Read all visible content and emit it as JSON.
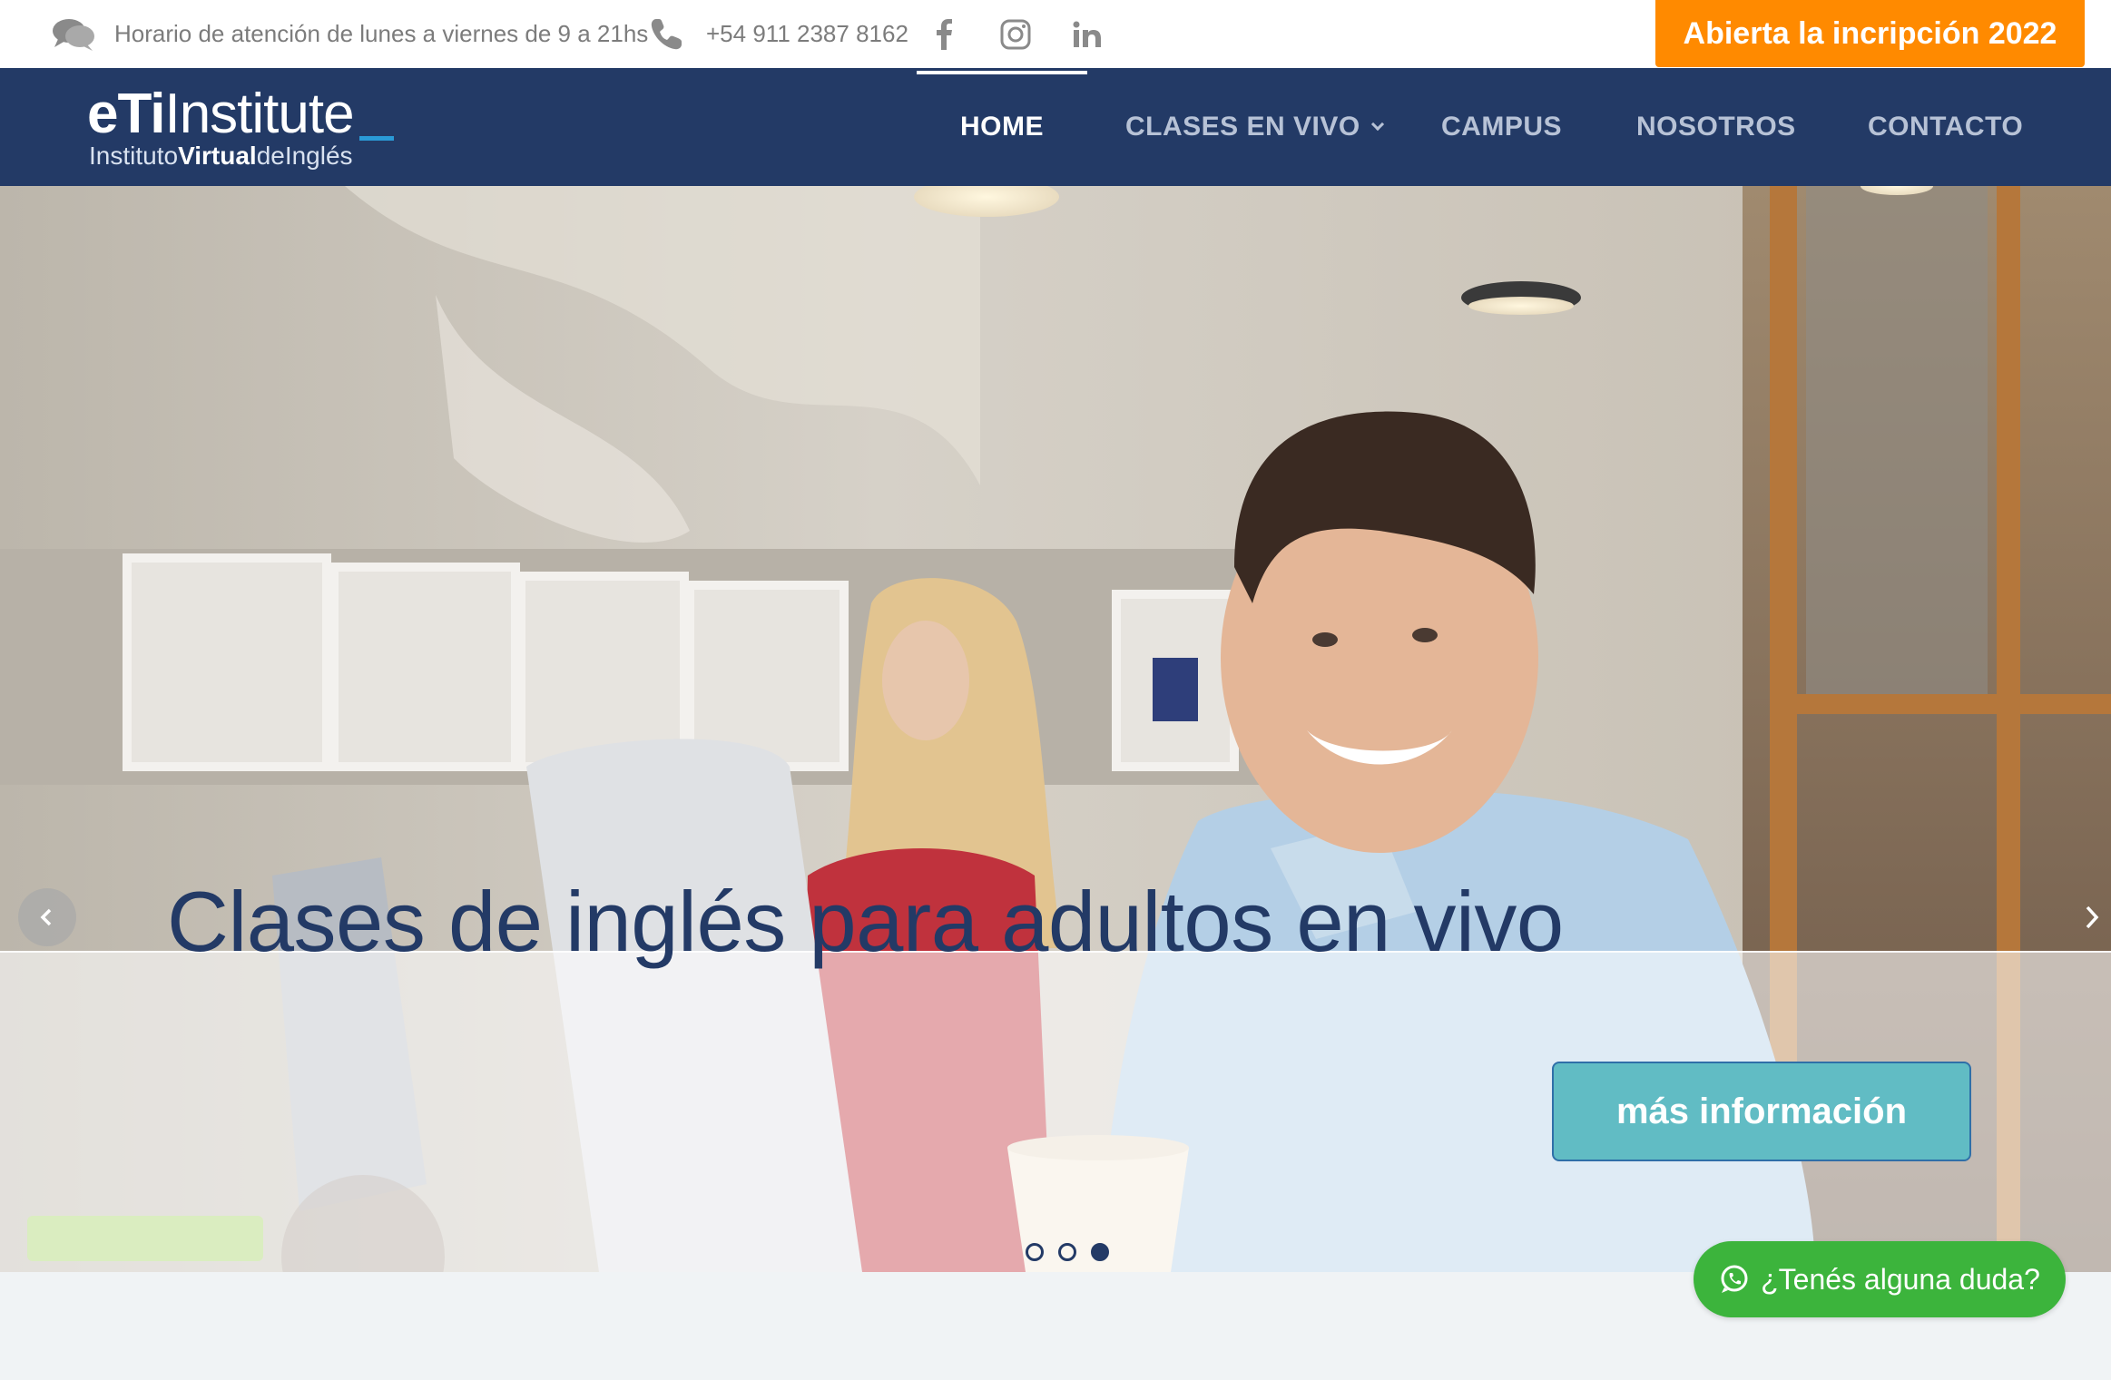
{
  "topbar": {
    "hours_icon": "chat-bubbles-icon",
    "hours_text": "Horario de atención de lunes a viernes de 9 a 21hs",
    "phone_icon": "phone-icon",
    "phone_text": "+54 911 2387 8162",
    "social": [
      "facebook-icon",
      "instagram-icon",
      "linkedin-icon"
    ],
    "cta_label": "Abierta la incripción 2022"
  },
  "logo": {
    "brand_bold": "eTi",
    "brand_rest": "Institute",
    "sub_pre": "Instituto",
    "sub_bold": "Virtual",
    "sub_post": "deInglés"
  },
  "nav": {
    "items": [
      {
        "label": "HOME",
        "active": true
      },
      {
        "label": "CLASES EN VIVO",
        "has_dropdown": true
      },
      {
        "label": "CAMPUS"
      },
      {
        "label": "NOSOTROS"
      },
      {
        "label": "CONTACTO"
      }
    ]
  },
  "hero": {
    "headline": "Clases de inglés para adultos en vivo",
    "button_label": "más información",
    "slides": 3,
    "active_slide": 3
  },
  "whatsapp": {
    "icon": "whatsapp-icon",
    "label": "¿Tenés alguna duda?"
  },
  "colors": {
    "nav_bg": "#233a66",
    "cta_orange": "#ff8a00",
    "button_teal": "#61bcc4",
    "whatsapp_green": "#3cb43c"
  }
}
